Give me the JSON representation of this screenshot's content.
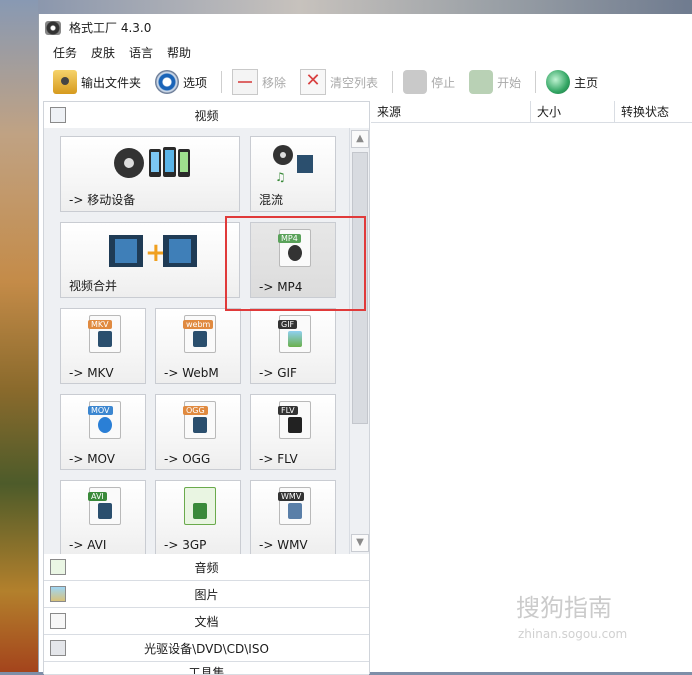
{
  "window": {
    "title": "格式工厂 4.3.0"
  },
  "menu": [
    "任务",
    "皮肤",
    "语言",
    "帮助"
  ],
  "toolbar": {
    "output_folder": "输出文件夹",
    "options": "选项",
    "remove": "移除",
    "clear_list": "清空列表",
    "stop": "停止",
    "start": "开始",
    "home": "主页"
  },
  "categories": {
    "video": "视频",
    "audio": "音频",
    "image": "图片",
    "document": "文档",
    "rom": "光驱设备\\DVD\\CD\\ISO",
    "tools": "工具集"
  },
  "tiles": {
    "mobile": "-> 移动设备",
    "mux": "混流",
    "join": "视频合并",
    "mp4": "-> MP4",
    "mkv": "-> MKV",
    "webm": "-> WebM",
    "gif": "-> GIF",
    "mov": "-> MOV",
    "ogg": "-> OGG",
    "flv": "-> FLV",
    "avi": "-> AVI",
    "3gp": "-> 3GP",
    "wmv": "-> WMV"
  },
  "file_tags": {
    "mp4": "MP4",
    "mkv": "MKV",
    "webm": "webm",
    "gif": "GIF",
    "mov": "MOV",
    "ogg": "OGG",
    "flv": "FLV",
    "avi": "AVI",
    "wmv": "WMV"
  },
  "columns": [
    "来源",
    "大小",
    "转换状态"
  ],
  "watermark": {
    "main": "搜狗指南",
    "url": "zhinan.sogou.com"
  },
  "colors": {
    "highlight": "#e03a3a",
    "accent": "#1a64b8"
  }
}
